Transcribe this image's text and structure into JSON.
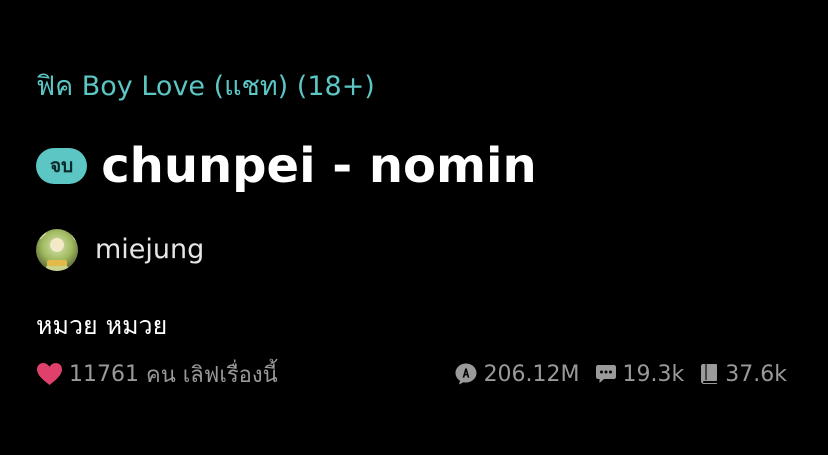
{
  "story": {
    "category": "ฟิค Boy Love (แชท) (18+)",
    "status_badge": "จบ",
    "title": "chunpei - nomin",
    "tagline": "หมวย หมวย"
  },
  "author": {
    "name": "miejung"
  },
  "likes": {
    "count": "11761",
    "unit": "คน",
    "text": "เลิฟเรื่องนี้"
  },
  "stats": {
    "views": "206.12M",
    "comments": "19.3k",
    "chapters": "37.6k"
  },
  "icons": {
    "heart": "heart-icon",
    "views": "view-count-icon",
    "comments": "comment-icon",
    "chapters": "book-icon"
  },
  "colors": {
    "accent": "#5cc6c4",
    "heart": "#e0406c",
    "muted": "#9a9a9a",
    "background": "#000000"
  }
}
